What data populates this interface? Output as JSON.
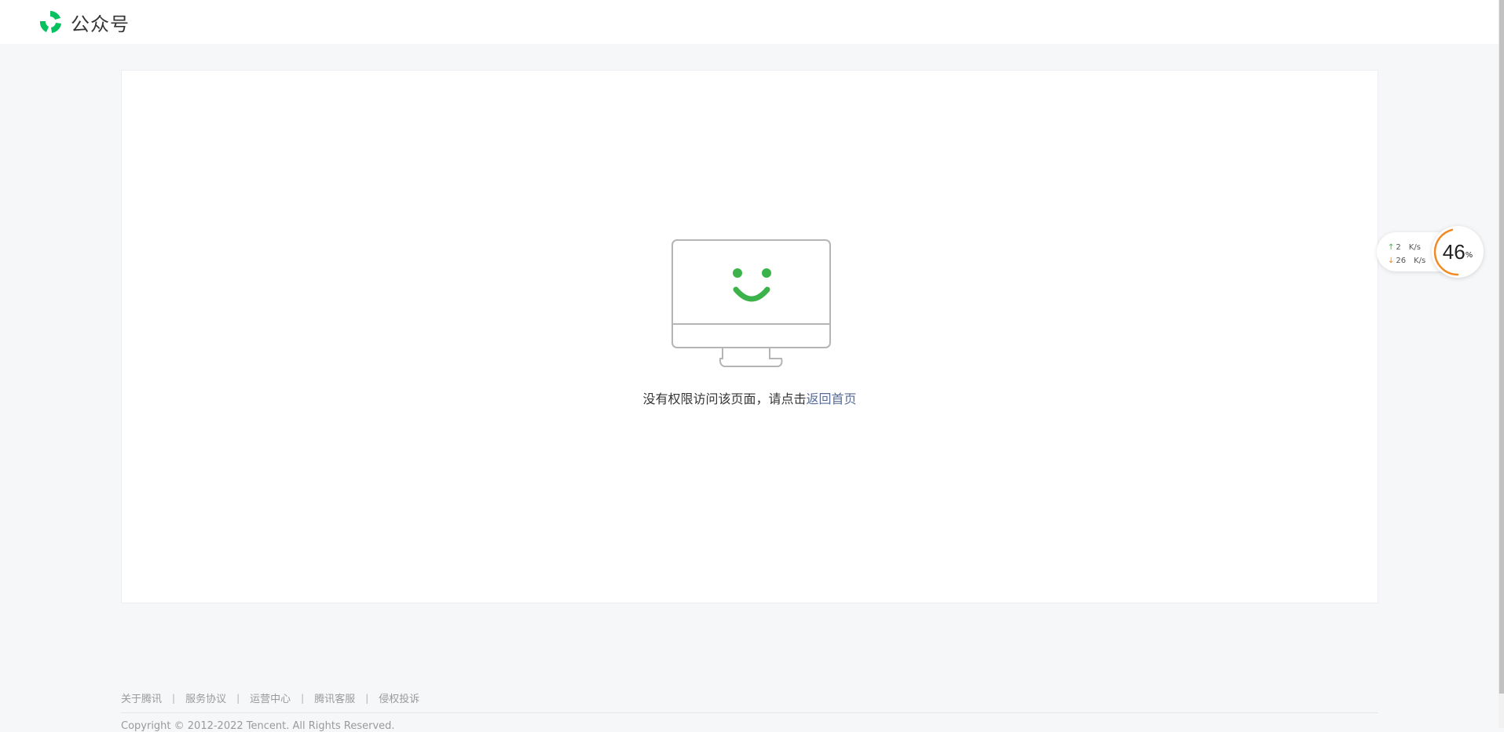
{
  "header": {
    "logo_text": "公众号",
    "brand_color": "#07c160"
  },
  "main": {
    "message_prefix": "没有权限访问该页面，请点击",
    "home_link": "返回首页",
    "link_color": "#576b95",
    "illustration_icon": "monitor-smile-icon"
  },
  "footer": {
    "links": [
      "关于腾讯",
      "服务协议",
      "运营中心",
      "腾讯客服",
      "侵权投诉"
    ],
    "separator": "|",
    "copyright": "Copyright © 2012-2022 Tencent. All Rights Reserved."
  },
  "net_widget": {
    "upload_value": "2",
    "upload_unit": "K/s",
    "download_value": "26",
    "download_unit": "K/s",
    "usage_value": "46",
    "usage_unit": "%",
    "usage_fraction": 0.46,
    "gauge_color": "#f08a24"
  }
}
